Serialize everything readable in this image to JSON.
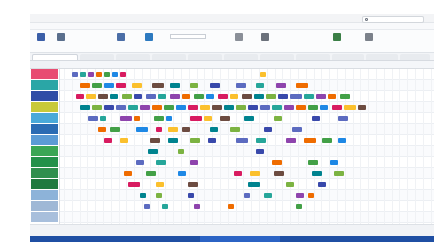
{
  "app": {
    "title": "",
    "search_placeholder": ""
  },
  "menu": [
    "",
    "",
    "",
    "",
    "",
    "",
    "",
    "",
    ""
  ],
  "ribbon": {
    "buttons": [
      {
        "label": "",
        "icon": "calendar-icon",
        "color": "#3b5fa8"
      },
      {
        "label": "",
        "icon": "list-icon",
        "color": "#5a6f8d"
      },
      {
        "label": "",
        "icon": "grid-icon",
        "color": "#4b6ea7"
      },
      {
        "label": "",
        "icon": "resource-icon",
        "color": "#2d7ac0"
      },
      {
        "label": "",
        "icon": "filter-icon",
        "color": "#8a8f98"
      },
      {
        "label": "",
        "icon": "print-icon",
        "color": "#6b717b"
      },
      {
        "label": "",
        "icon": "export-icon",
        "color": "#3b7f46"
      },
      {
        "label": "",
        "icon": "settings-icon",
        "color": "#7b818a"
      }
    ],
    "input_value": ""
  },
  "tabs": [
    "",
    "",
    "",
    "",
    "",
    "",
    "",
    "",
    "",
    "",
    ""
  ],
  "resources": [
    {
      "label": "",
      "color": "#e84c72"
    },
    {
      "label": "",
      "color": "#2aa6a6"
    },
    {
      "label": "",
      "color": "#2f4da6"
    },
    {
      "label": "",
      "color": "#c8c93a"
    },
    {
      "label": "",
      "color": "#4aa9d9"
    },
    {
      "label": "",
      "color": "#2b6bb3"
    },
    {
      "label": "",
      "color": "#5b9bd5"
    },
    {
      "label": "",
      "color": "#3aa655"
    },
    {
      "label": "",
      "color": "#23914a"
    },
    {
      "label": "",
      "color": "#2f8f4e"
    },
    {
      "label": "",
      "color": "#1f7a3f"
    },
    {
      "label": "",
      "color": "#8db3d9"
    },
    {
      "label": "",
      "color": "#9fb8d6"
    },
    {
      "label": "",
      "color": "#a8bfdc"
    }
  ],
  "timescale": {
    "ticks": [
      "",
      "",
      "",
      "",
      "",
      "",
      "",
      "",
      "",
      "",
      "",
      "",
      "",
      "",
      "",
      "",
      "",
      "",
      "",
      "",
      "",
      "",
      "",
      "",
      "",
      "",
      "",
      "",
      "",
      "",
      "",
      "",
      "",
      "",
      "",
      "",
      "",
      "",
      "",
      "",
      "",
      "",
      "",
      "",
      "",
      "",
      "",
      "",
      "",
      "",
      "",
      "",
      "",
      "",
      "",
      "",
      "",
      "",
      "",
      "",
      "",
      "",
      "",
      "",
      "",
      "",
      "",
      "",
      "",
      "",
      "",
      "",
      "",
      "",
      "",
      "",
      "",
      "",
      "",
      "",
      "",
      "",
      "",
      "",
      "",
      "",
      "",
      "",
      "",
      "",
      "",
      "",
      ""
    ]
  },
  "status": {
    "left": "",
    "right": ""
  },
  "colors": {
    "accent": "#1f4fa3",
    "event_palette": [
      "#5c6bc0",
      "#26a69a",
      "#8e44ad",
      "#ef6c00",
      "#43a047",
      "#1e88e5",
      "#d81b60",
      "#fbc02d",
      "#6d4c41",
      "#00838f",
      "#7cb342",
      "#3949ab"
    ]
  }
}
